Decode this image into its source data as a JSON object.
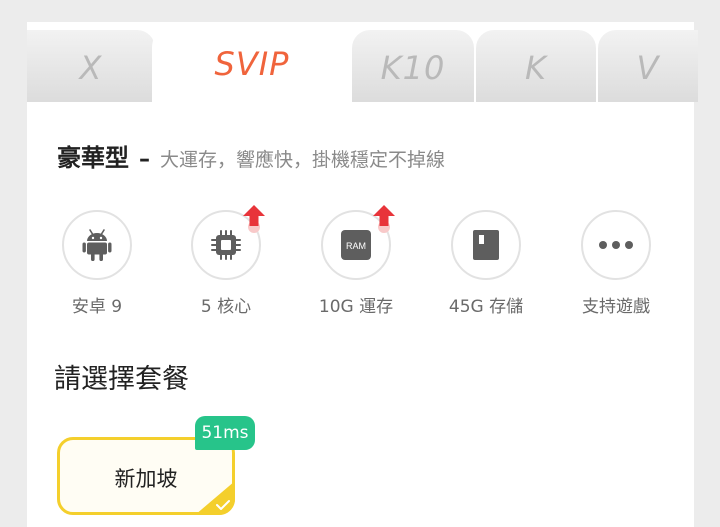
{
  "colors": {
    "accent": "#f0643c",
    "plan_border": "#f4cf2c",
    "latency_bg": "#27c48a",
    "upgrade_red": "#e8343a"
  },
  "tabs": [
    {
      "label": "X",
      "active": false
    },
    {
      "label": "SVIP",
      "active": true
    },
    {
      "label": "K10",
      "active": false
    },
    {
      "label": "K",
      "active": false
    },
    {
      "label": "V",
      "active": false
    }
  ],
  "headline": {
    "type": "豪華型",
    "dash": "–",
    "description": "大運存，響應快，掛機穩定不掉線"
  },
  "features": [
    {
      "icon": "android-icon",
      "label": "安卓 9",
      "upgraded": false
    },
    {
      "icon": "cpu-chip-icon",
      "label": "5 核心",
      "upgraded": true
    },
    {
      "icon": "ram-icon",
      "icon_text": "RAM",
      "label": "10G 運存",
      "upgraded": true
    },
    {
      "icon": "sd-card-icon",
      "label": "45G 存儲",
      "upgraded": false
    },
    {
      "icon": "more-dots-icon",
      "label": "支持遊戲",
      "upgraded": false
    }
  ],
  "section_title": "請選擇套餐",
  "plan": {
    "name": "新加坡",
    "latency": "51ms",
    "selected": true
  }
}
